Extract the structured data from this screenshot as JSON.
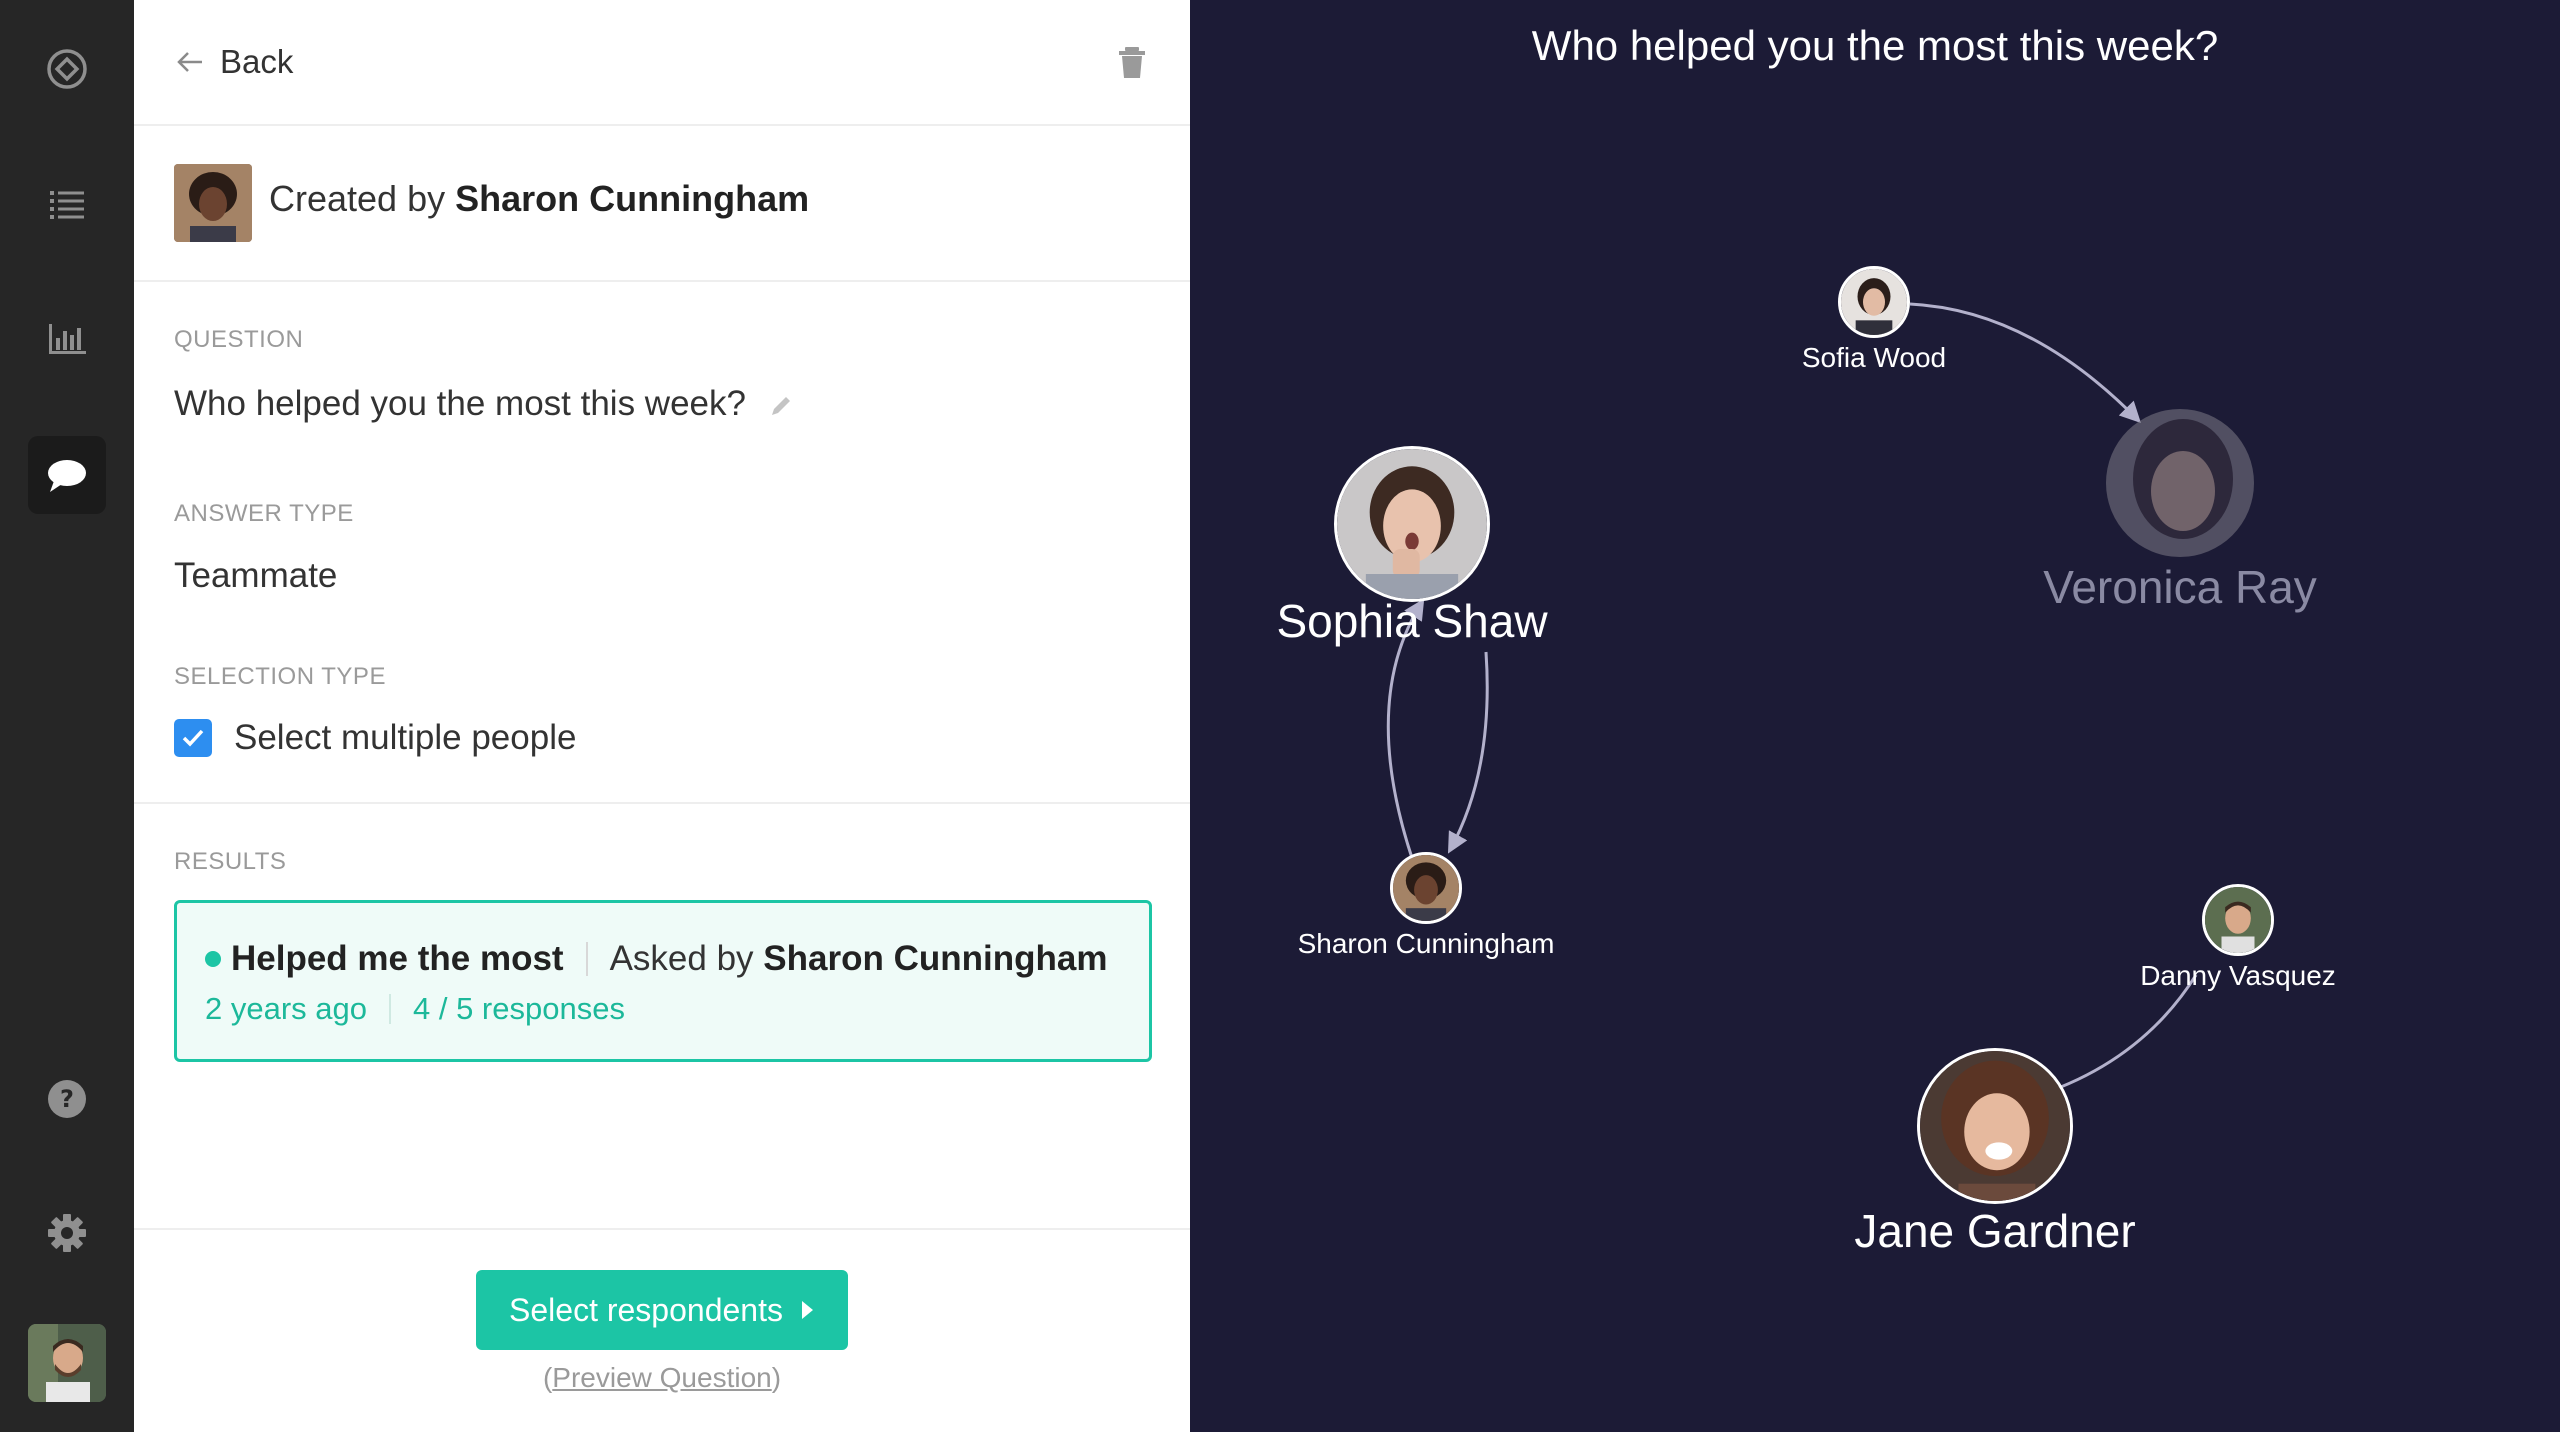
{
  "nav": {
    "items": [
      {
        "name": "logo-icon"
      },
      {
        "name": "list-icon"
      },
      {
        "name": "chart-icon"
      },
      {
        "name": "chat-icon",
        "active": true
      },
      {
        "name": "help-icon"
      },
      {
        "name": "gear-icon"
      }
    ]
  },
  "header": {
    "back_label": "Back"
  },
  "creator": {
    "prefix": "Created by",
    "name": "Sharon Cunningham"
  },
  "question": {
    "label": "QUESTION",
    "text": "Who helped you the most this week?"
  },
  "answer_type": {
    "label": "ANSWER TYPE",
    "value": "Teammate"
  },
  "selection_type": {
    "label": "SELECTION TYPE",
    "option": "Select multiple people",
    "checked": true
  },
  "results": {
    "label": "RESULTS",
    "title": "Helped me the most",
    "asked_prefix": "Asked by",
    "asked_by": "Sharon Cunningham",
    "time": "2 years ago",
    "responses": "4 / 5 responses"
  },
  "footer": {
    "primary_label": "Select respondents",
    "preview_open": "(",
    "preview_label": "Preview Question",
    "preview_close": ")"
  },
  "graph": {
    "title": "Who helped you the most this week?",
    "nodes": {
      "sofia": "Sofia Wood",
      "veronica": "Veronica Ray",
      "sophia": "Sophia Shaw",
      "sharon": "Sharon Cunningham",
      "danny": "Danny Vasquez",
      "jane": "Jane Gardner"
    }
  },
  "colors": {
    "accent": "#1cc5a5",
    "checkbox": "#2d8ef0",
    "graph_bg": "#1c1b36",
    "rail_bg": "#262626"
  }
}
